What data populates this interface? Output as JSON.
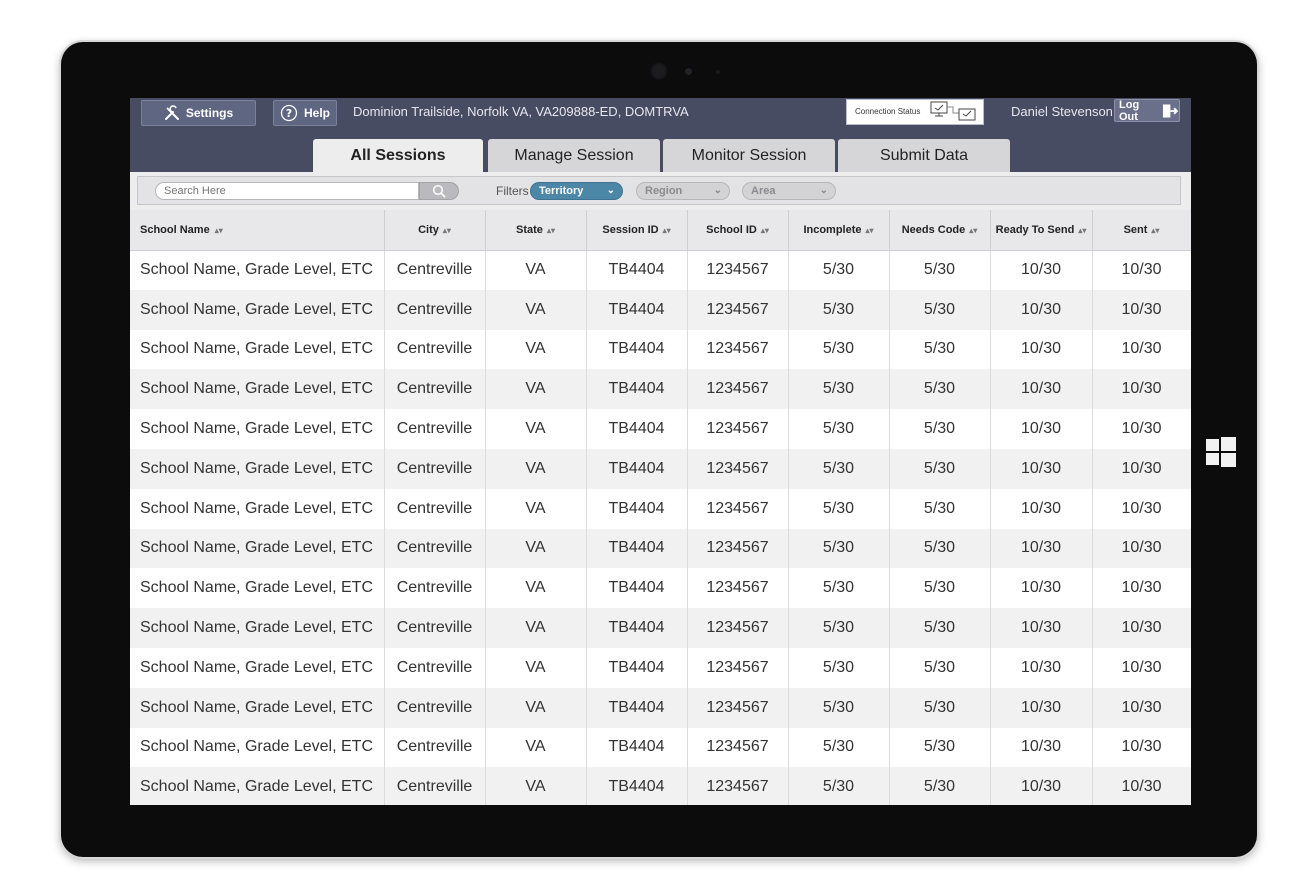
{
  "header": {
    "settings_label": "Settings",
    "help_label": "Help",
    "location": "Dominion Trailside, Norfolk VA, VA209888-ED, DOMTRVA",
    "connection_status_label": "Connection Status",
    "user_name": "Daniel Stevenson",
    "logout_label": "Log Out"
  },
  "tabs": [
    {
      "label": "All Sessions",
      "active": true
    },
    {
      "label": "Manage Session",
      "active": false
    },
    {
      "label": "Monitor Session",
      "active": false
    },
    {
      "label": "Submit Data",
      "active": false
    }
  ],
  "filters": {
    "search_placeholder": "Search Here",
    "filters_label": "Filters",
    "territory": "Territory",
    "region": "Region",
    "area": "Area"
  },
  "table": {
    "columns": [
      "School Name",
      "City",
      "State",
      "Session ID",
      "School ID",
      "Incomplete",
      "Needs Code",
      "Ready To Send",
      "Sent"
    ],
    "rows": [
      [
        "School Name, Grade Level, ETC",
        "Centreville",
        "VA",
        "TB4404",
        "1234567",
        "5/30",
        "5/30",
        "10/30",
        "10/30"
      ],
      [
        "School Name, Grade Level, ETC",
        "Centreville",
        "VA",
        "TB4404",
        "1234567",
        "5/30",
        "5/30",
        "10/30",
        "10/30"
      ],
      [
        "School Name, Grade Level, ETC",
        "Centreville",
        "VA",
        "TB4404",
        "1234567",
        "5/30",
        "5/30",
        "10/30",
        "10/30"
      ],
      [
        "School Name, Grade Level, ETC",
        "Centreville",
        "VA",
        "TB4404",
        "1234567",
        "5/30",
        "5/30",
        "10/30",
        "10/30"
      ],
      [
        "School Name, Grade Level, ETC",
        "Centreville",
        "VA",
        "TB4404",
        "1234567",
        "5/30",
        "5/30",
        "10/30",
        "10/30"
      ],
      [
        "School Name, Grade Level, ETC",
        "Centreville",
        "VA",
        "TB4404",
        "1234567",
        "5/30",
        "5/30",
        "10/30",
        "10/30"
      ],
      [
        "School Name, Grade Level, ETC",
        "Centreville",
        "VA",
        "TB4404",
        "1234567",
        "5/30",
        "5/30",
        "10/30",
        "10/30"
      ],
      [
        "School Name, Grade Level, ETC",
        "Centreville",
        "VA",
        "TB4404",
        "1234567",
        "5/30",
        "5/30",
        "10/30",
        "10/30"
      ],
      [
        "School Name, Grade Level, ETC",
        "Centreville",
        "VA",
        "TB4404",
        "1234567",
        "5/30",
        "5/30",
        "10/30",
        "10/30"
      ],
      [
        "School Name, Grade Level, ETC",
        "Centreville",
        "VA",
        "TB4404",
        "1234567",
        "5/30",
        "5/30",
        "10/30",
        "10/30"
      ],
      [
        "School Name, Grade Level, ETC",
        "Centreville",
        "VA",
        "TB4404",
        "1234567",
        "5/30",
        "5/30",
        "10/30",
        "10/30"
      ],
      [
        "School Name, Grade Level, ETC",
        "Centreville",
        "VA",
        "TB4404",
        "1234567",
        "5/30",
        "5/30",
        "10/30",
        "10/30"
      ],
      [
        "School Name, Grade Level, ETC",
        "Centreville",
        "VA",
        "TB4404",
        "1234567",
        "5/30",
        "5/30",
        "10/30",
        "10/30"
      ],
      [
        "School Name, Grade Level, ETC",
        "Centreville",
        "VA",
        "TB4404",
        "1234567",
        "5/30",
        "5/30",
        "10/30",
        "10/30"
      ]
    ]
  },
  "colors": {
    "header_bg": "#474c63",
    "accent_dropdown": "#4d87a8",
    "tablet_bezel": "#0c0c0d"
  }
}
